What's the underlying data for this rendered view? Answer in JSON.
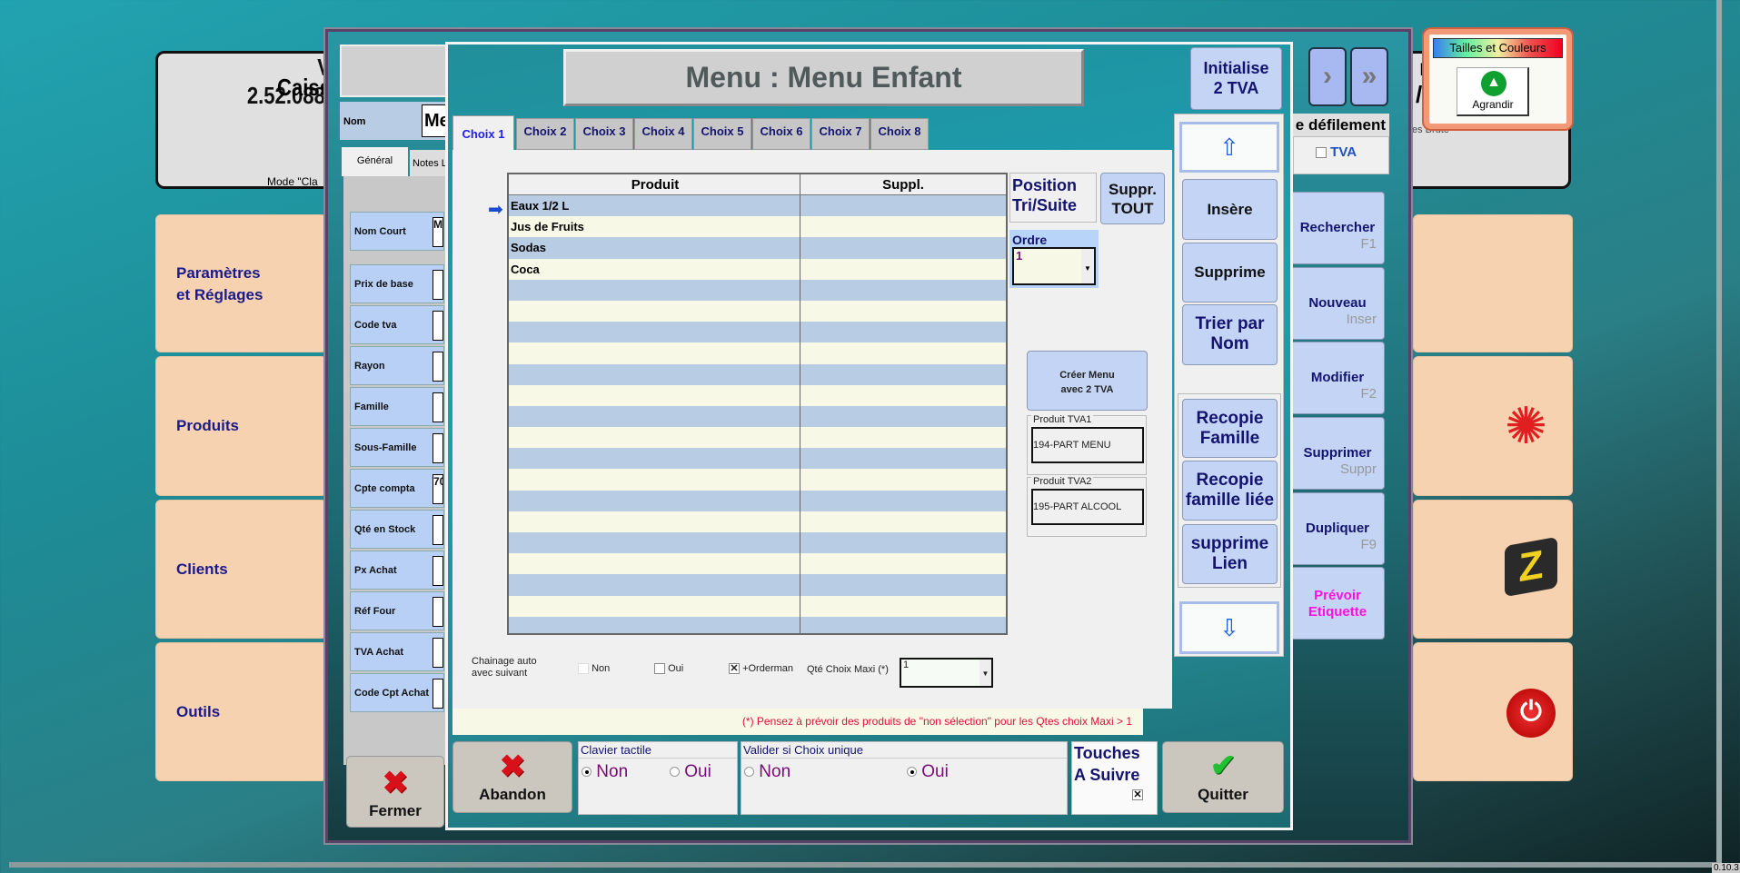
{
  "background": {
    "version": "V 2.52.088.",
    "caisse": "Caiss",
    "mode": "Mode \"Cla",
    "right_fragment_1": "r",
    "right_fragment_2": "/2",
    "right_fragment_3": "es Brute",
    "corner_version": "0.10.3"
  },
  "left_tiles": [
    {
      "label": "Paramètres\net Réglages"
    },
    {
      "label": "Produits"
    },
    {
      "label": "Clients"
    },
    {
      "label": "Outils"
    }
  ],
  "right_tiles": [
    {
      "icon": "blank"
    },
    {
      "icon": "euro-sun-icon"
    },
    {
      "icon": "z-book-icon"
    },
    {
      "icon": "power-icon"
    }
  ],
  "tailles": {
    "title": "Tailles et Couleurs",
    "button": "Agrandir"
  },
  "product_dialog": {
    "nom_label": "Nom",
    "nom_value": "Me",
    "tabs": [
      "Général",
      "Notes L"
    ],
    "fields": [
      {
        "label": "Nom Court",
        "value": "M"
      },
      {
        "label": "Prix de base",
        "value": ""
      },
      {
        "label": "Code tva",
        "value": ""
      },
      {
        "label": "Rayon",
        "value": ""
      },
      {
        "label": "Famille",
        "value": ""
      },
      {
        "label": "Sous-Famille",
        "value": ""
      },
      {
        "label": "Cpte compta",
        "value": "70"
      },
      {
        "label": "Qté en Stock",
        "value": ""
      },
      {
        "label": "Px Achat",
        "value": ""
      },
      {
        "label": "Réf Four",
        "value": ""
      },
      {
        "label": "TVA  Achat",
        "value": ""
      },
      {
        "label": "Code Cpt Achat",
        "value": ""
      }
    ],
    "close_button": "Fermer",
    "defilement_label": "e défilement",
    "tva_checkbox": "TVA",
    "actions": [
      {
        "label": "Rechercher",
        "key": "F1"
      },
      {
        "label": "Nouveau",
        "key": "Inser"
      },
      {
        "label": "Modifier",
        "key": "F2"
      },
      {
        "label": "Supprimer",
        "key": "Suppr"
      },
      {
        "label": "Dupliquer",
        "key": "F9"
      },
      {
        "label": "Prévoir\nEtiquette",
        "key": ""
      }
    ]
  },
  "menu_dialog": {
    "title": "Menu : Menu Enfant",
    "init_button": "Initialise\n2 TVA",
    "tabs": [
      "Choix 1",
      "Choix 2",
      "Choix 3",
      "Choix 4",
      "Choix 5",
      "Choix 6",
      "Choix 7",
      "Choix 8"
    ],
    "active_tab": "Choix 1",
    "grid": {
      "headers": [
        "Produit",
        "Suppl."
      ],
      "rows": [
        {
          "produit": "Eaux 1/2 L",
          "suppl": ""
        },
        {
          "produit": "Jus de Fruits",
          "suppl": ""
        },
        {
          "produit": "Sodas",
          "suppl": ""
        },
        {
          "produit": "Coca",
          "suppl": ""
        }
      ],
      "selected_row": 0
    },
    "position_label": "Position\nTri/Suite",
    "suppr_tout": "Suppr.\nTOUT",
    "ordre_label": "Ordre",
    "ordre_value": "1",
    "creer_menu": "Créer Menu\navec 2 TVA",
    "produit_tva1_label": "Produit TVA1",
    "produit_tva1_value": "194-PART MENU",
    "produit_tva2_label": "Produit TVA2",
    "produit_tva2_value": "195-PART ALCOOL",
    "chainage_label": "Chainage auto\navec suivant",
    "chainage_non": {
      "label": "Non",
      "checked": false
    },
    "chainage_oui": {
      "label": "Oui",
      "checked": false
    },
    "orderman": {
      "label": "+Orderman",
      "checked": true
    },
    "qte_label": "Qté Choix Maxi (*)",
    "qte_value": "1",
    "note": "(*) Pensez à prévoir des produits de \"non sélection\" pour les Qtes choix Maxi > 1",
    "side_buttons": {
      "insere": "Insère",
      "supprime": "Supprime",
      "trier": "Trier par\nNom",
      "recopie_famille": "Recopie\nFamille",
      "recopie_liee": "Recopie\nfamille liée",
      "supprime_lien": "supprime\nLien"
    },
    "abandon": "Abandon",
    "clavier": {
      "label": "Clavier tactile",
      "options": [
        "Non",
        "Oui"
      ],
      "selected": "Non"
    },
    "valider": {
      "label": "Valider si Choix unique",
      "options": [
        "Non",
        "Oui"
      ],
      "selected": "Oui"
    },
    "touches": {
      "label": "Touches\nA Suivre",
      "checked": true
    },
    "quitter": "Quitter"
  },
  "colors": {
    "accent_blue": "#141470",
    "button_blue": "#c3d4f4",
    "tile_peach": "#f6d2b0",
    "note_red": "#e0103a",
    "magenta": "#ff10e0"
  }
}
